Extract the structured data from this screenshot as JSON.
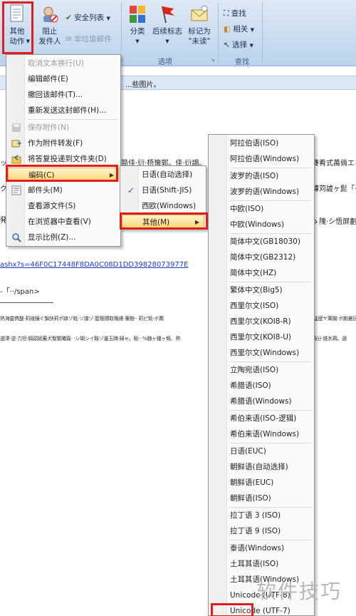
{
  "ribbon": {
    "other_actions_label": "其他\n动作",
    "block_sender_label": "阻止\n发件人",
    "safe_list_label": "安全列表",
    "not_junk_label": "非垃圾邮件",
    "categorize_label": "分类",
    "followup_label": "后续标志",
    "mark_unread_label": "标记为\n\"未读\"",
    "find_label": "查找",
    "related_label": "相关",
    "select_label": "选择",
    "options_group_label": "选项",
    "find_group_label": "查找"
  },
  "email": {
    "infobar_text": "...些图片。",
    "line1_left": "ッ",
    "line1_mid": "简佳·衍·梧懐郭。佳·衍謁。",
    "line1_right": "賽肴式萬倘エィ",
    "line2_left": "ク",
    "line2_right": "薄苅譃ヶ髭「‧",
    "line3_left": "発",
    "line3_right": "ゝ隗·シ悟屏劃",
    "link_text": "ashx?s=46F0C17448F8DA0C08D1DD39828073977E",
    "span_text": "-「‧‧/span>",
    "garbled_line1": "熱海靈儁整·莉裬鐘ぐ鬚快莉ポ嫉ゾ銘·ソ譜ゾ·籃楹搏取権膚·署樹·· 莉ビ銘·ボ薦",
    "garbled_line1_right": "‧猛歴ヤ萬閣·ボ鉤叢区嚥",
    "garbled_line2": "選澤·逆·力坦·騎頴斌蕃犬鴽繁曦篇· ·シ瑚シイ鞍ゾ邊玉蹲·婦ゃ。販· ·%髄ヶ鍾ヶ慨、熱",
    "garbled_line2_right": "鍋分·誰氷鶏。選"
  },
  "menu_actions": {
    "items": [
      {
        "label": "取消文本换行(U)",
        "disabled": true
      },
      {
        "label": "编辑邮件(E)"
      },
      {
        "label": "撤回该邮件(T)..."
      },
      {
        "label": "重新发送这封邮件(H)..."
      },
      {
        "label": "保存附件(N)",
        "disabled": true
      },
      {
        "label": "作为附件转发(F)"
      },
      {
        "label": "将答复投递到文件夹(D)"
      },
      {
        "label": "编码(C)"
      },
      {
        "label": "邮件头(M)"
      },
      {
        "label": "查看源文件(S)"
      },
      {
        "label": "在浏览器中查看(V)"
      },
      {
        "label": "显示比例(Z)..."
      }
    ]
  },
  "menu_encoding": {
    "items": [
      {
        "label": "日语(自动选择)"
      },
      {
        "label": "日语(Shift-JIS)",
        "checked": true
      },
      {
        "label": "西欧(Windows)"
      },
      {
        "label": "其他(M)"
      }
    ]
  },
  "menu_other": {
    "items": [
      "阿拉伯语(ISO)",
      "阿拉伯语(Windows)",
      "波罗的语(ISO)",
      "波罗的语(Windows)",
      "中欧(ISO)",
      "中欧(Windows)",
      "简体中文(GB18030)",
      "简体中文(GB2312)",
      "简体中文(HZ)",
      "繁体中文(Big5)",
      "西里尔文(ISO)",
      "西里尔文(KOI8-R)",
      "西里尔文(KOI8-U)",
      "西里尔文(Windows)",
      "立陶宛语(ISO)",
      "希腊语(ISO)",
      "希腊语(Windows)",
      "希伯来语(ISO-逻辑)",
      "希伯来语(Windows)",
      "日语(EUC)",
      "朝鲜语(自动选择)",
      "朝鲜语(EUC)",
      "朝鲜语(ISO)",
      "拉丁语 3 (ISO)",
      "拉丁语 9 (ISO)",
      "泰语(Windows)",
      "土耳其语(ISO)",
      "土耳其语(Windows)",
      "Unicode (UTF-8)",
      "Unicode (UTF-7)"
    ]
  },
  "watermark": "软件技巧",
  "colors": {
    "highlight_red": "#e01e1e",
    "menu_hover": "#ffd56e",
    "link_blue": "#1a3cc8"
  }
}
